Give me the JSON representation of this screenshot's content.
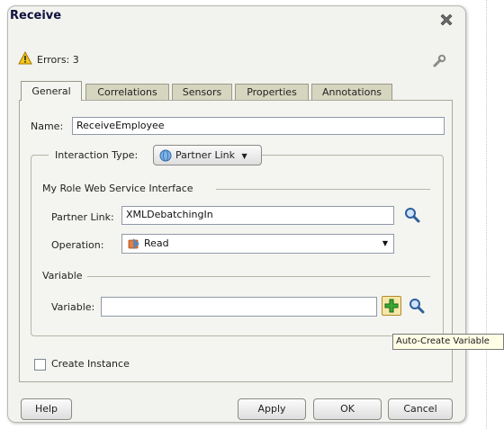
{
  "dialog": {
    "title": "Receive"
  },
  "status": {
    "errors_text": "Errors: 3"
  },
  "tabs": [
    {
      "label": "General"
    },
    {
      "label": "Correlations"
    },
    {
      "label": "Sensors"
    },
    {
      "label": "Properties"
    },
    {
      "label": "Annotations"
    }
  ],
  "general": {
    "name_label": "Name:",
    "name_value": "ReceiveEmployee",
    "interaction_type_label": "Interaction Type:",
    "interaction_type_value": "Partner Link",
    "my_role_group_label": "My Role Web Service Interface",
    "partner_link_label": "Partner Link:",
    "partner_link_value": "XMLDebatchingIn",
    "operation_label": "Operation:",
    "operation_value": "Read",
    "variable_group_label": "Variable",
    "variable_label": "Variable:",
    "variable_value": "",
    "create_instance_label": "Create Instance",
    "create_instance_checked": false
  },
  "tooltip": {
    "text": "Auto-Create Variable"
  },
  "buttons": {
    "help": "Help",
    "apply": "Apply",
    "ok": "OK",
    "cancel": "Cancel"
  }
}
